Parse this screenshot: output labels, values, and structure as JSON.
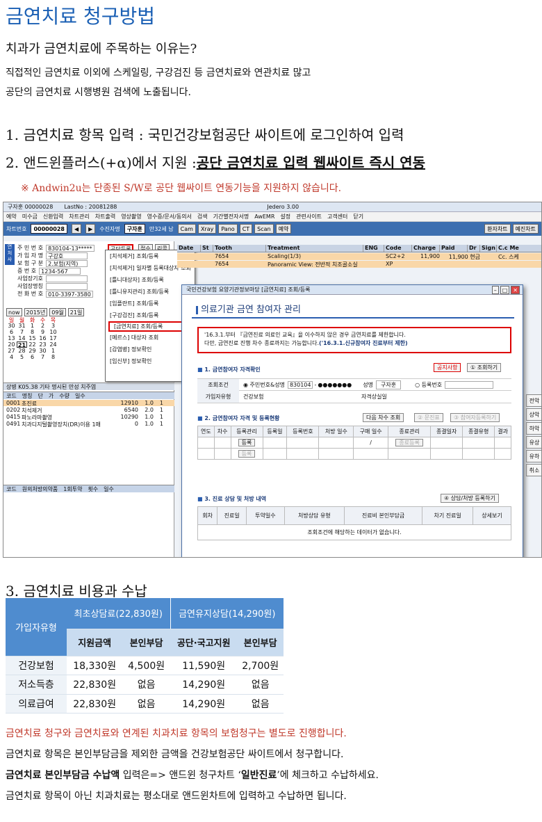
{
  "doc": {
    "title": "금연치료 청구방법",
    "question": "치과가 금연치료에 주목하는 이유는?",
    "para1": "직접적인 금연치료 이외에 스케일링, 구강검진 등 금연치료와 연관치료 많고",
    "para2": "공단의 금연치료 시행병원 검색에 노출됩니다.",
    "h1": "1. 금연치료 항목 입력 : 국민건강보험공단 싸이트에 로그인하여 입력",
    "h2_prefix": "2. 앤드윈플러스(+α)에서 지원 :",
    "h2_bold": "공단 금연치료 입력 웹싸이트 즉시 연동",
    "note": "※ Andwin2u는 단종된 S/W로 공단 웹싸이트 연동기능을 지원하지 않습니다.",
    "h3": "3. 금연치료 비용과 수납",
    "foot1": "금연치료 청구와 금연치료와 연계된 치과치료 항목의 보험청구는 별도로 진행합니다.",
    "foot2": "금연치료 항목은 본인부담금을 제외한 금액을 건강보험공단 싸이트에서 청구합니다.",
    "foot3_bold": "금연치료 본인부담금 수납액",
    "foot3_a": " 입력은=> 앤드윈 청구차트 ‘",
    "foot3_b": "일반진료",
    "foot3_c": "’에 체크하고 수납하세요.",
    "foot4": "금연치료 항목이 아닌 치과치료는 평소대로 앤드윈차트에 입력하고 수납하면 됩니다."
  },
  "shot": {
    "app_title": "구자훈 00000028",
    "last_no": "LastNo : 20081288",
    "version": "Jedero 3.00",
    "menu": [
      "예약",
      "미수금",
      "신환입력",
      "차트관리",
      "차트출력",
      "영상촬영",
      "영수증/문서/동의서",
      "검색",
      "기간별전자서명",
      "AwEMR",
      "설정",
      "관련사이트",
      "고객센터",
      "닫기"
    ],
    "chart_label": "차트번호",
    "chart_no": "00000028",
    "patient_label": "수진자명",
    "patient_name": "구자훈",
    "age": "만32세 남",
    "tool_btns": [
      "Cam",
      "Xray",
      "Pano",
      "CT",
      "Scan",
      "예약"
    ],
    "right_btns": [
      "환자차트",
      "예진차트"
    ],
    "patient_info": [
      {
        "k": "주 민 번 호",
        "v": "830104-13*****"
      },
      {
        "k": "가 입 자 명",
        "v": "구강호"
      },
      {
        "k": "보 험 구 분",
        "v": "2.보험(지역)"
      },
      {
        "k": "증 번 호",
        "v": "1234-567"
      },
      {
        "k": "사업장기호",
        "v": ""
      },
      {
        "k": "사업장명칭",
        "v": ""
      },
      {
        "k": "전 화 번 호",
        "v": "010-3397-3580"
      }
    ],
    "btn_gongdan": "공단등록",
    "btn_jeopsu": "접수",
    "btn_recall": "리콜",
    "popup": [
      "[치석제거] 조회/등록",
      "[치석제거] 일자별 등록대상자 조회",
      "[틀니대상자] 조회/등록",
      "[틀니유지관리] 조회/등록",
      "[임플란트] 조회/등록",
      "[구강검진] 조회/등록",
      "[금연치료] 조회/등록",
      "[메르스] 대상자 조회",
      "[감염병] 정보확인",
      "[임신부] 정보확인"
    ],
    "cal_year": "2015년",
    "cal_month": "09월",
    "cal_day": "21일",
    "cal_days": [
      "일",
      "월",
      "화",
      "수",
      "목"
    ],
    "cal_rows": [
      [
        "30",
        "31",
        "1",
        "2",
        "3"
      ],
      [
        "6",
        "7",
        "8",
        "9",
        "10"
      ],
      [
        "13",
        "14",
        "15",
        "16",
        "17"
      ],
      [
        "20",
        "21",
        "22",
        "23",
        "24"
      ],
      [
        "27",
        "28",
        "29",
        "30",
        "1"
      ],
      [
        "4",
        "5",
        "6",
        "7",
        "8"
      ]
    ],
    "sangbyeong": "상병 K05.38  기타 명시된 만성 치주염",
    "code_hd": [
      "코드",
      "명칭",
      "단",
      "가",
      "수량",
      "일수"
    ],
    "codes": [
      [
        "0001",
        "초진료",
        "12910",
        "1.0",
        "1"
      ],
      [
        "0202",
        "치석제거",
        "6540",
        "2.0",
        "1"
      ],
      [
        "0415",
        "파노라마촬영",
        "10290",
        "1.0",
        "1"
      ],
      [
        "0491",
        "치과디지털촬영장치(DR)이용 1매",
        "0",
        "1.0",
        "1"
      ]
    ],
    "code_hd2": [
      "코드",
      "원외처방의약품",
      "1회투약",
      "횟수",
      "일수"
    ],
    "grid_hd": [
      "Date",
      "St",
      "Tooth",
      "Treatment",
      "ENG",
      "Code",
      "Charge",
      "Paid",
      "Dr",
      "Sign",
      "C.c Me"
    ],
    "grid_rows": [
      {
        "tooth": "7654",
        "treat": "Scaling(1/3)",
        "code": "SC2+2",
        "charge": "11,900",
        "paid": "11,900 현금",
        "cc": "Cc. 스케"
      },
      {
        "tooth": "7654",
        "treat": "Panoramic View: 전반적 치조골소실",
        "code": "XP",
        "charge": "",
        "paid": "",
        "cc": ""
      }
    ],
    "right_side": [
      "전악",
      "상악",
      "하악",
      "유상",
      "유하",
      "취소"
    ],
    "dialog": {
      "bar_title": "국민건강보험 요양기관정보마당 [금연치료] 조회/등록",
      "head": "의료기관 금연 참여자 관리",
      "warn1": "'16.3.1.부터 『금연진료 의료인 교육』을 이수하지 않은 경우 금연치료를 제한합니다.",
      "warn2a": "다만, 금연진료 진행 차수 종료까지는 가능합니다.",
      "warn2b": "('16.3.1.신규참여자 진료부터 제한)",
      "sec1": "1. 금연참여자 자격확인",
      "btn_notice": "공지사항",
      "btn_lookup": "① 조회하기",
      "lbl_cond": "조회조건",
      "opt_rrn": "주민번호&성명",
      "rrn_front": "830104",
      "rrn_back": "●●●●●●●",
      "lbl_name": "성명",
      "name_val": "구자훈",
      "opt_reg": "등록번호",
      "lbl_type": "가입자유형",
      "type_val": "건강보험",
      "lbl_loss": "자격상실일",
      "sec2": "2. 금연참여자 자격 및 등록현황",
      "btn_next": "다음 차수 조회",
      "btn_ask": "② 문진표",
      "btn_reg": "③ 참여자등록하기",
      "tbl2": [
        "연도",
        "차수",
        "등록관리",
        "등록일",
        "등록번호",
        "처방 일수",
        "구매 일수",
        "종료관리",
        "종결일자",
        "종결유형",
        "결과"
      ],
      "btn_dung": "등록",
      "btn_dung2": "등록",
      "btn_end": "종료등록",
      "slash": "/",
      "sec3": "3. 진료 상담 및 처방 내역",
      "btn_consult": "④ 상담/처방 등록하기",
      "tbl3": [
        "회차",
        "진료일",
        "투약일수",
        "처방상담 유형",
        "진료비 본인부담금",
        "차기 진료일",
        "상세보기"
      ],
      "empty": "조회조건에 해당하는 데이터가 없습니다."
    }
  },
  "cost": {
    "col_type": "가입자유형",
    "grp1": "최초상담료(22,830원)",
    "grp2": "금연유지상담(14,290원)",
    "sub": [
      "지원금액",
      "본인부담",
      "공단·국고지원",
      "본인부담"
    ],
    "rows": [
      [
        "건강보험",
        "18,330원",
        "4,500원",
        "11,590원",
        "2,700원"
      ],
      [
        "저소득층",
        "22,830원",
        "없음",
        "14,290원",
        "없음"
      ],
      [
        "의료급여",
        "22,830원",
        "없음",
        "14,290원",
        "없음"
      ]
    ]
  }
}
